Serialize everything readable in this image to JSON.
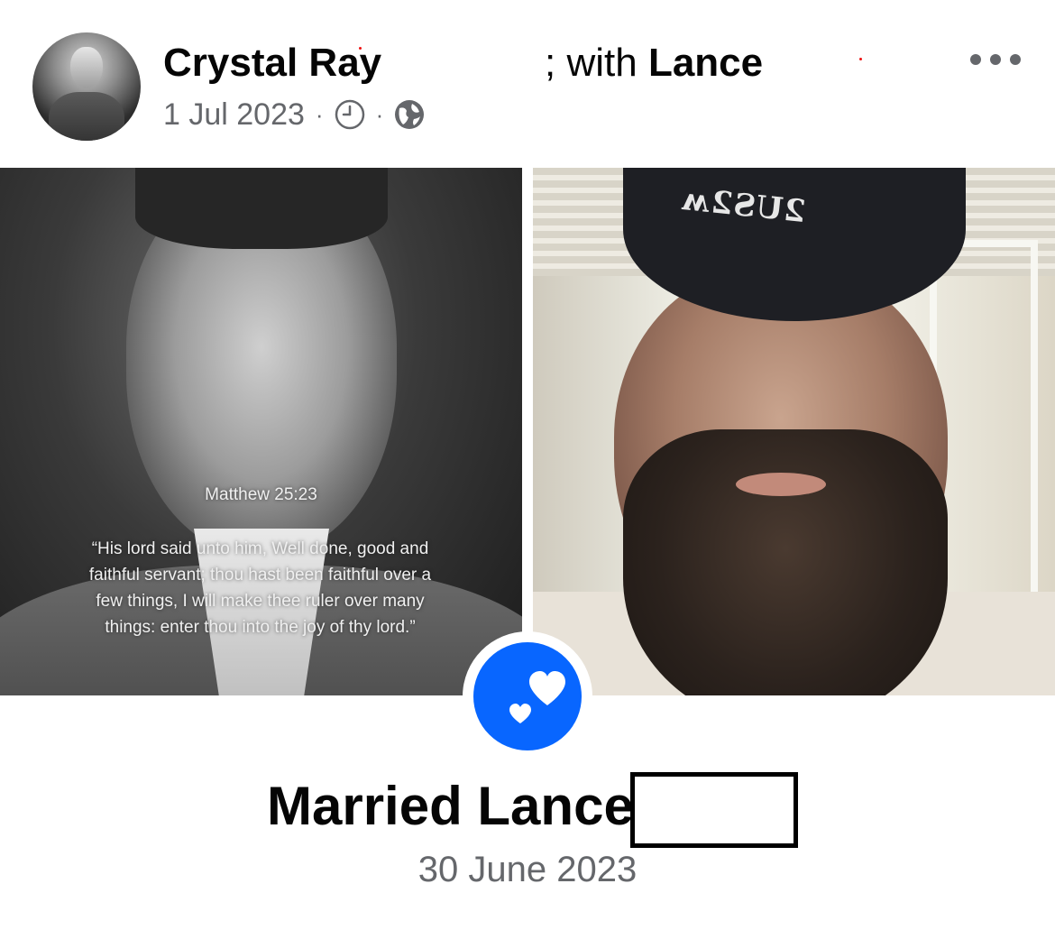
{
  "post": {
    "author": "Crystal Ray",
    "with_fragment": "; with",
    "tagged_person": "Lance",
    "date": "1 Jul 2023",
    "separator": "·",
    "clock_icon": "clock-icon",
    "audience_icon": "globe-icon",
    "more_icon": "more-horizontal-icon"
  },
  "left_photo": {
    "reference": "Matthew 25:23",
    "quote": "“His lord said unto him, Well done, good and faithful servant; thou hast been faithful over a few things, I will make thee ruler over many things: enter thou into the joy of thy lord.”"
  },
  "right_photo": {
    "cap_text": "2US2ʍ"
  },
  "life_event": {
    "icon": "hearts-icon",
    "title": "Married Lance",
    "date": "30 June 2023"
  },
  "colors": {
    "accent": "#0866ff",
    "secondary_text": "#65676b",
    "primary_text": "#050505"
  }
}
